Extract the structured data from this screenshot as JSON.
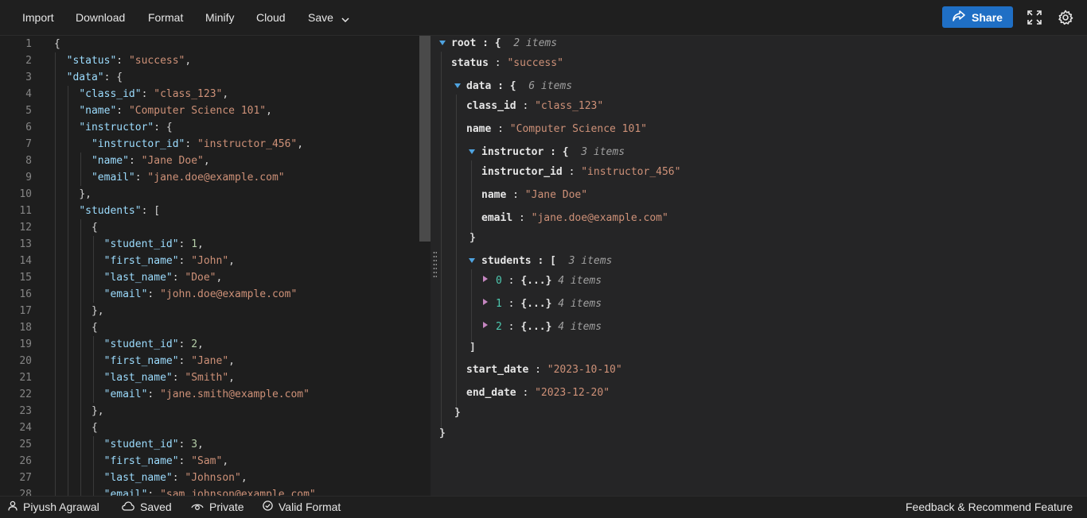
{
  "menu": {
    "import": "Import",
    "download": "Download",
    "format": "Format",
    "minify": "Minify",
    "cloud": "Cloud",
    "save": "Save",
    "share": "Share"
  },
  "editor": {
    "line_numbers": [
      "1",
      "2",
      "3",
      "4",
      "5",
      "6",
      "7",
      "8",
      "9",
      "10",
      "11",
      "12",
      "13",
      "14",
      "15",
      "16",
      "17",
      "18",
      "19",
      "20",
      "21",
      "22",
      "23",
      "24",
      "25",
      "26",
      "27",
      "28"
    ]
  },
  "tree": {
    "root_key": "root",
    "root_count": "2 items",
    "status_key": "status",
    "status_value": "\"success\"",
    "data_key": "data",
    "data_count": "6 items",
    "class_id_key": "class_id",
    "class_id_value": "\"class_123\"",
    "name_key": "name",
    "name_value": "\"Computer Science 101\"",
    "instructor_key": "instructor",
    "instructor_count": "3 items",
    "instructor_id_key": "instructor_id",
    "instructor_id_value": "\"instructor_456\"",
    "iname_key": "name",
    "iname_value": "\"Jane Doe\"",
    "iemail_key": "email",
    "iemail_value": "\"jane.doe@example.com\"",
    "students_key": "students",
    "students_count": "3 items",
    "student_items": [
      {
        "index": "0",
        "collapsed": "{...}",
        "count": "4 items"
      },
      {
        "index": "1",
        "collapsed": "{...}",
        "count": "4 items"
      },
      {
        "index": "2",
        "collapsed": "{...}",
        "count": "4 items"
      }
    ],
    "start_date_key": "start_date",
    "start_date_value": "\"2023-10-10\"",
    "end_date_key": "end_date",
    "end_date_value": "\"2023-12-20\""
  },
  "status": {
    "user": "Piyush Agrawal",
    "saved": "Saved",
    "privacy": "Private",
    "validity": "Valid Format",
    "feedback": "Feedback & Recommend Feature"
  },
  "icons": {
    "share": "share-icon",
    "fullscreen": "fullscreen-icon",
    "settings": "gear-icon",
    "user": "user-icon",
    "cloud": "cloud-icon",
    "private": "eye-icon",
    "valid": "check-circle-icon"
  },
  "colors": {
    "accent": "#1f6fc5",
    "json_key": "#9cdcfe",
    "json_string": "#ce9178",
    "json_number": "#b5cea8"
  }
}
